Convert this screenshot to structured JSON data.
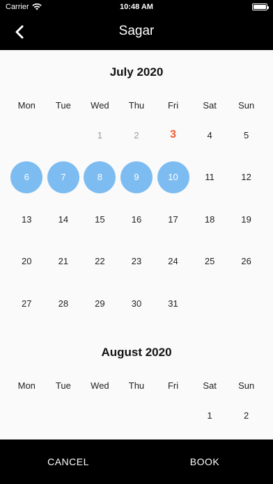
{
  "status_bar": {
    "carrier": "Carrier",
    "time": "10:48 AM"
  },
  "header": {
    "title": "Sagar",
    "back_icon": "chevron-left-icon"
  },
  "weekdays": [
    "Mon",
    "Tue",
    "Wed",
    "Thu",
    "Fri",
    "Sat",
    "Sun"
  ],
  "months": [
    {
      "title": "July 2020",
      "leading_blanks": 2,
      "days": [
        "1",
        "2",
        "3",
        "4",
        "5",
        "6",
        "7",
        "8",
        "9",
        "10",
        "11",
        "12",
        "13",
        "14",
        "15",
        "16",
        "17",
        "18",
        "19",
        "20",
        "21",
        "22",
        "23",
        "24",
        "25",
        "26",
        "27",
        "28",
        "29",
        "30",
        "31"
      ],
      "past_days": [
        "1",
        "2"
      ],
      "today": "3",
      "selected_days": [
        "6",
        "7",
        "8",
        "9",
        "10"
      ]
    },
    {
      "title": "August 2020",
      "leading_blanks": 5,
      "days": [
        "1",
        "2"
      ],
      "past_days": [],
      "today": "",
      "selected_days": []
    }
  ],
  "colors": {
    "selected": "#7dbcf1",
    "today": "#ef5a2f",
    "bar": "#000000"
  },
  "actions": {
    "cancel_label": "CANCEL",
    "book_label": "BOOK"
  }
}
